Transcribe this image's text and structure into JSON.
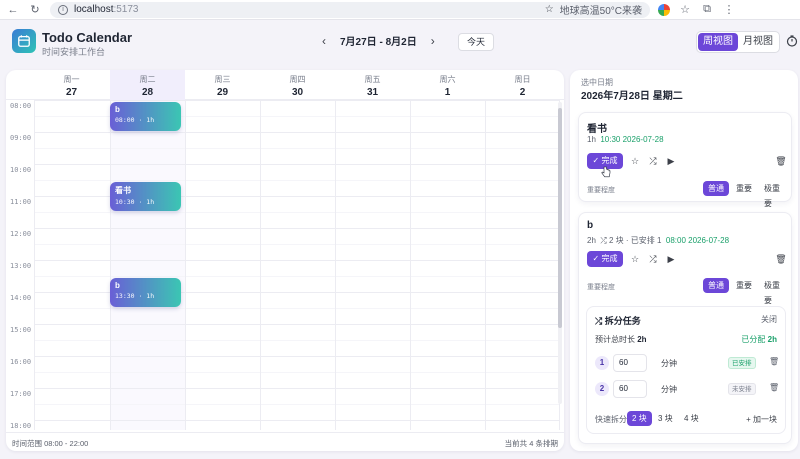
{
  "browser": {
    "url_host": "localhost",
    "url_port": ":5173",
    "weather": "地球高温50°C来袭"
  },
  "header": {
    "title": "Todo Calendar",
    "subtitle": "时间安排工作台",
    "week_range": "7月27日 - 8月2日",
    "today_label": "今天",
    "view_week": "周视图",
    "view_month": "月视图"
  },
  "calendar": {
    "days": [
      {
        "weekday": "周一",
        "date": "27"
      },
      {
        "weekday": "周二",
        "date": "28"
      },
      {
        "weekday": "周三",
        "date": "29"
      },
      {
        "weekday": "周四",
        "date": "30"
      },
      {
        "weekday": "周五",
        "date": "31"
      },
      {
        "weekday": "周六",
        "date": "1"
      },
      {
        "weekday": "周日",
        "date": "2"
      }
    ],
    "hours": [
      "08:00",
      "09:00",
      "10:00",
      "11:00",
      "12:00",
      "13:00",
      "14:00",
      "15:00",
      "16:00",
      "17:00",
      "18:00"
    ],
    "events": [
      {
        "title": "b",
        "time": "08:00 · 1h"
      },
      {
        "title": "看书",
        "time": "10:30 · 1h"
      },
      {
        "title": "b",
        "time": "13:30 · 1h"
      }
    ],
    "footer_range": "时间范围 08:00 - 22:00",
    "footer_count": "当前共 4 条排期"
  },
  "sidebar": {
    "label": "选中日期",
    "date": "2026年7月28日 星期二",
    "tasks": [
      {
        "name": "看书",
        "duration": "1h",
        "schedule": "10:30 2026-07-28",
        "done_label": "完成",
        "priority_label": "重要程度",
        "priorities": [
          "普通",
          "重要",
          "极重要"
        ]
      },
      {
        "name": "b",
        "duration": "2h",
        "split_info": "⤮ 2 块 · 已安排 1",
        "schedule": "08:00 2026-07-28",
        "done_label": "完成",
        "priority_label": "重要程度",
        "priorities": [
          "普通",
          "重要",
          "极重要"
        ]
      }
    ],
    "split": {
      "title": "拆分任务",
      "close": "关闭",
      "total_label": "预计总时长",
      "total_value": "2h",
      "allocated_label": "已分配",
      "allocated_value": "2h",
      "rows": [
        {
          "index": "1",
          "value": "60",
          "unit": "分钟",
          "status": "已安排"
        },
        {
          "index": "2",
          "value": "60",
          "unit": "分钟",
          "status": "未安排"
        }
      ],
      "quick_label": "快速拆分",
      "quick_options": [
        "2 块",
        "3 块",
        "4 块"
      ],
      "add_label": "+ 加一块"
    }
  },
  "colors": {
    "accent": "#6c47d8",
    "event_start": "#6a5fd6",
    "event_end": "#3bc6b3",
    "success": "#1aa06a"
  }
}
